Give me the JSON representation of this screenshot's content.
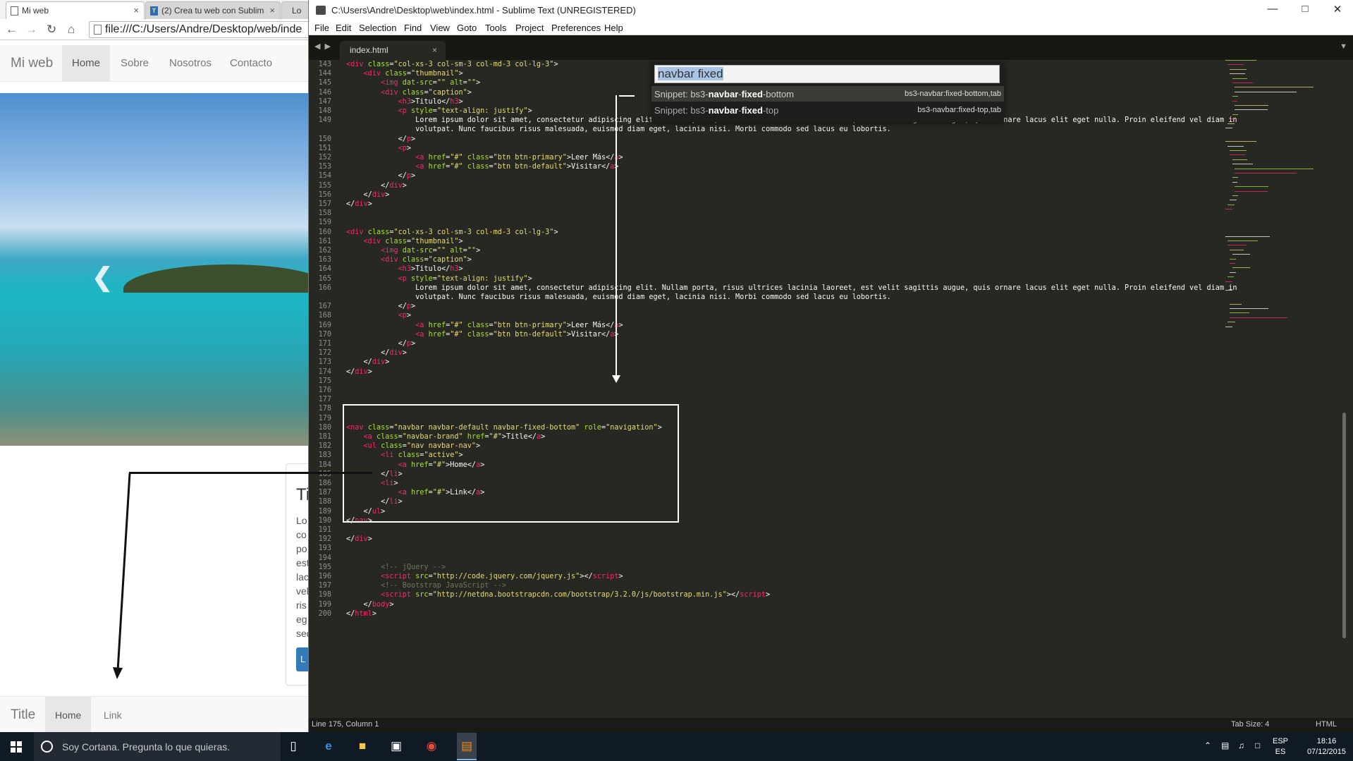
{
  "browser": {
    "tabs": [
      {
        "title": "Mi web",
        "close": "×"
      },
      {
        "title": "(2) Crea tu web con Sublim",
        "close": "×"
      },
      {
        "title": "Lo"
      }
    ],
    "address": "file:///C:/Users/Andre/Desktop/web/inde"
  },
  "site": {
    "brand": "Mi web",
    "nav": [
      "Home",
      "Sobre",
      "Nosotros",
      "Contacto"
    ],
    "card_title": "Ti",
    "card_text": [
      "Lo",
      "co",
      "po",
      "est",
      "lac",
      "vel",
      "ris",
      "eg",
      "sed"
    ],
    "card_button": "L",
    "bottom_brand": "Title",
    "bottom_nav": [
      "Home",
      "Link"
    ]
  },
  "sublime": {
    "title": "C:\\Users\\Andre\\Desktop\\web\\index.html - Sublime Text (UNREGISTERED)",
    "menu": [
      "File",
      "Edit",
      "Selection",
      "Find",
      "View",
      "Goto",
      "Tools",
      "Project",
      "Preferences",
      "Help"
    ],
    "tab": "index.html",
    "tab_close": "×",
    "palette": {
      "query": "navbar fixed",
      "results": [
        {
          "pre": "Snippet: bs3-",
          "bold1": "navbar",
          "mid": "-",
          "bold2": "fixed",
          "post": "-bottom",
          "trigger": "bs3-navbar:fixed-bottom,tab"
        },
        {
          "pre": "Snippet: bs3-",
          "bold1": "navbar",
          "mid": "-",
          "bold2": "fixed",
          "post": "-top",
          "trigger": "bs3-navbar:fixed-top,tab"
        }
      ]
    },
    "status_left": "Line 175, Column 1",
    "status_tabsize": "Tab Size: 4",
    "status_syntax": "HTML",
    "code": [
      {
        "n": "143",
        "h": "<span class=t>&lt;div</span> <span class=a>class</span>=<span class=s>\"col-xs-3 col-sm-3 col-md-3 col-lg-3\"</span>&gt;"
      },
      {
        "n": "144",
        "h": "    <span class=t>&lt;div</span> <span class=a>class</span>=<span class=s>\"thumbnail\"</span>&gt;"
      },
      {
        "n": "145",
        "h": "        <span class=t>&lt;img</span> <span class=a>dat-src</span>=<span class=s>\"\"</span> <span class=a>alt</span>=<span class=s>\"\"</span>&gt;"
      },
      {
        "n": "146",
        "h": "        <span class=t>&lt;div</span> <span class=a>class</span>=<span class=s>\"caption\"</span>&gt;"
      },
      {
        "n": "147",
        "h": "            <span class=t>&lt;h3</span>&gt;Titulo&lt;/<span class=t>h3</span>&gt;"
      },
      {
        "n": "148",
        "h": "            <span class=t>&lt;p</span> <span class=a>style</span>=<span class=s>\"text-align: justify\"</span>&gt;"
      },
      {
        "n": "149",
        "h": "                Lorem ipsum dolor sit amet, consectetur adipiscing elit. Nullam porta, risus ultrices lacinia laoreet, est velit sagittis augue, quis ornare lacus elit eget nulla. Proin eleifend vel diam in"
      },
      {
        "n": "",
        "h": "                volutpat. Nunc faucibus risus malesuada, euismod diam eget, lacinia nisi. Morbi commodo sed lacus eu lobortis."
      },
      {
        "n": "150",
        "h": "            &lt;/<span class=t>p</span>&gt;"
      },
      {
        "n": "151",
        "h": "            <span class=t>&lt;p</span>&gt;"
      },
      {
        "n": "152",
        "h": "                <span class=t>&lt;a</span> <span class=a>href</span>=<span class=s>\"#\"</span> <span class=a>class</span>=<span class=s>\"btn btn-primary\"</span>&gt;Leer Más&lt;/<span class=t>a</span>&gt;"
      },
      {
        "n": "153",
        "h": "                <span class=t>&lt;a</span> <span class=a>href</span>=<span class=s>\"#\"</span> <span class=a>class</span>=<span class=s>\"btn btn-default\"</span>&gt;Visitar&lt;/<span class=t>a</span>&gt;"
      },
      {
        "n": "154",
        "h": "            &lt;/<span class=t>p</span>&gt;"
      },
      {
        "n": "155",
        "h": "        &lt;/<span class=t>div</span>&gt;"
      },
      {
        "n": "156",
        "h": "    &lt;/<span class=t>div</span>&gt;"
      },
      {
        "n": "157",
        "h": "&lt;/<span class=t>div</span>&gt;"
      },
      {
        "n": "158",
        "h": ""
      },
      {
        "n": "159",
        "h": ""
      },
      {
        "n": "160",
        "h": "<span class=t>&lt;div</span> <span class=a>class</span>=<span class=s>\"col-xs-3 col-sm-3 col-md-3 col-lg-3\"</span>&gt;"
      },
      {
        "n": "161",
        "h": "    <span class=t>&lt;div</span> <span class=a>class</span>=<span class=s>\"thumbnail\"</span>&gt;"
      },
      {
        "n": "162",
        "h": "        <span class=t>&lt;img</span> <span class=a>dat-src</span>=<span class=s>\"\"</span> <span class=a>alt</span>=<span class=s>\"\"</span>&gt;"
      },
      {
        "n": "163",
        "h": "        <span class=t>&lt;div</span> <span class=a>class</span>=<span class=s>\"caption\"</span>&gt;"
      },
      {
        "n": "164",
        "h": "            <span class=t>&lt;h3</span>&gt;Titulo&lt;/<span class=t>h3</span>&gt;"
      },
      {
        "n": "165",
        "h": "            <span class=t>&lt;p</span> <span class=a>style</span>=<span class=s>\"text-align: justify\"</span>&gt;"
      },
      {
        "n": "166",
        "h": "                Lorem ipsum dolor sit amet, consectetur adipiscing elit. Nullam porta, risus ultrices lacinia laoreet, est velit sagittis augue, quis ornare lacus elit eget nulla. Proin eleifend vel diam in"
      },
      {
        "n": "",
        "h": "                volutpat. Nunc faucibus risus malesuada, euismod diam eget, lacinia nisi. Morbi commodo sed lacus eu lobortis."
      },
      {
        "n": "167",
        "h": "            &lt;/<span class=t>p</span>&gt;"
      },
      {
        "n": "168",
        "h": "            <span class=t>&lt;p</span>&gt;"
      },
      {
        "n": "169",
        "h": "                <span class=t>&lt;a</span> <span class=a>href</span>=<span class=s>\"#\"</span> <span class=a>class</span>=<span class=s>\"btn btn-primary\"</span>&gt;Leer Más&lt;/<span class=t>a</span>&gt;"
      },
      {
        "n": "170",
        "h": "                <span class=t>&lt;a</span> <span class=a>href</span>=<span class=s>\"#\"</span> <span class=a>class</span>=<span class=s>\"btn btn-default\"</span>&gt;Visitar&lt;/<span class=t>a</span>&gt;"
      },
      {
        "n": "171",
        "h": "            &lt;/<span class=t>p</span>&gt;"
      },
      {
        "n": "172",
        "h": "        &lt;/<span class=t>div</span>&gt;"
      },
      {
        "n": "173",
        "h": "    &lt;/<span class=t>div</span>&gt;"
      },
      {
        "n": "174",
        "h": "&lt;/<span class=t>div</span>&gt;"
      },
      {
        "n": "175",
        "h": ""
      },
      {
        "n": "176",
        "h": ""
      },
      {
        "n": "177",
        "h": ""
      },
      {
        "n": "178",
        "h": ""
      },
      {
        "n": "179",
        "h": ""
      },
      {
        "n": "180",
        "h": "<span class=t>&lt;nav</span> <span class=a>class</span>=<span class=s>\"navbar navbar-default navbar-fixed-bottom\"</span> <span class=a>role</span>=<span class=s>\"navigation\"</span>&gt;"
      },
      {
        "n": "181",
        "h": "    <span class=t>&lt;a</span> <span class=a>class</span>=<span class=s>\"navbar-brand\"</span> <span class=a>href</span>=<span class=s>\"#\"</span>&gt;Title&lt;/<span class=t>a</span>&gt;"
      },
      {
        "n": "182",
        "h": "    <span class=t>&lt;ul</span> <span class=a>class</span>=<span class=s>\"nav navbar-nav\"</span>&gt;"
      },
      {
        "n": "183",
        "h": "        <span class=t>&lt;li</span> <span class=a>class</span>=<span class=s>\"active\"</span>&gt;"
      },
      {
        "n": "184",
        "h": "            <span class=t>&lt;a</span> <span class=a>href</span>=<span class=s>\"#\"</span>&gt;Home&lt;/<span class=t>a</span>&gt;"
      },
      {
        "n": "185",
        "h": "        &lt;/<span class=t>li</span>&gt;"
      },
      {
        "n": "186",
        "h": "        <span class=t>&lt;li</span>&gt;"
      },
      {
        "n": "187",
        "h": "            <span class=t>&lt;a</span> <span class=a>href</span>=<span class=s>\"#\"</span>&gt;Link&lt;/<span class=t>a</span>&gt;"
      },
      {
        "n": "188",
        "h": "        &lt;/<span class=t>li</span>&gt;"
      },
      {
        "n": "189",
        "h": "    &lt;/<span class=t>ul</span>&gt;"
      },
      {
        "n": "190",
        "h": "&lt;/<span class=t>nav</span>&gt;"
      },
      {
        "n": "191",
        "h": ""
      },
      {
        "n": "192",
        "h": "&lt;/<span class=t>div</span>&gt;"
      },
      {
        "n": "193",
        "h": ""
      },
      {
        "n": "194",
        "h": ""
      },
      {
        "n": "195",
        "h": "        <span class=c>&lt;!-- jQuery --&gt;</span>"
      },
      {
        "n": "196",
        "h": "        <span class=t>&lt;script</span> <span class=a>src</span>=<span class=s>\"http://code.jquery.com/jquery.js\"</span>&gt;&lt;/<span class=t>script</span>&gt;"
      },
      {
        "n": "197",
        "h": "        <span class=c>&lt;!-- Bootstrap JavaScript --&gt;</span>"
      },
      {
        "n": "198",
        "h": "        <span class=t>&lt;script</span> <span class=a>src</span>=<span class=s>\"http://netdna.bootstrapcdn.com/bootstrap/3.2.0/js/bootstrap.min.js\"</span>&gt;&lt;/<span class=t>script</span>&gt;"
      },
      {
        "n": "199",
        "h": "    &lt;/<span class=t>body</span>&gt;"
      },
      {
        "n": "200",
        "h": "&lt;/<span class=t>html</span>&gt;"
      }
    ]
  },
  "taskbar": {
    "search_placeholder": "Soy Cortana. Pregunta lo que quieras.",
    "lang_top": "ESP",
    "lang_bottom": "ES",
    "time": "18:16",
    "date": "07/12/2015"
  }
}
